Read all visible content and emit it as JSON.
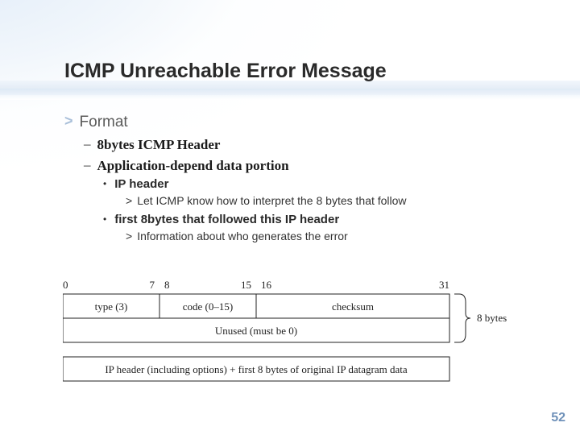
{
  "title": "ICMP Unreachable Error Message",
  "bullets": {
    "format": "Format",
    "h1": "8bytes ICMP Header",
    "h2": "Application-depend data portion",
    "h2a": "IP header",
    "h2a1": "Let ICMP know how to interpret the 8 bytes that follow",
    "h2b": "first 8bytes that followed this IP header",
    "h2b1": "Information about who generates the error"
  },
  "diagram": {
    "bits": {
      "b0": "0",
      "b7": "7",
      "b8": "8",
      "b15": "15",
      "b16": "16",
      "b31": "31"
    },
    "row1": {
      "type": "type (3)",
      "code": "code (0–15)",
      "checksum": "checksum"
    },
    "row2": "Unused (must be 0)",
    "row3": "IP header (including options) + first 8 bytes of original IP datagram data",
    "brace": "8 bytes"
  },
  "page": "52"
}
